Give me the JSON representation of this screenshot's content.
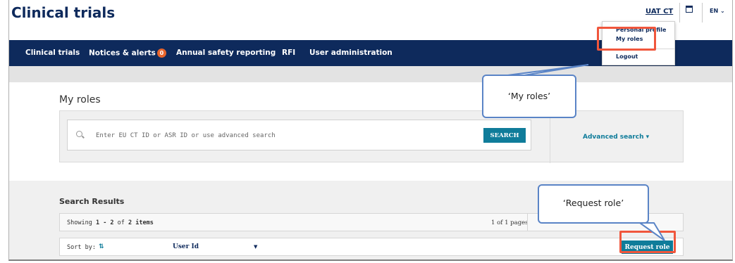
{
  "header": {
    "app_title": "Clinical trials",
    "user_link": "UAT CT",
    "calendar_icon": "calendar-icon",
    "language": "EN ⌄"
  },
  "nav": {
    "items": [
      {
        "label": "Clinical trials"
      },
      {
        "label": "Notices & alerts",
        "badge": "0"
      },
      {
        "label": "Annual safety reporting"
      },
      {
        "label": "RFI"
      },
      {
        "label": "User administration"
      }
    ]
  },
  "user_menu": {
    "items": [
      {
        "label": "Personal profile"
      },
      {
        "label": "My roles"
      },
      {
        "label": "Logout"
      }
    ]
  },
  "page": {
    "heading": "My roles"
  },
  "search": {
    "icon": "search-icon",
    "placeholder": "Enter EU CT ID or ASR ID or use advanced search",
    "button_label": "SEARCH",
    "advanced_label": "Advanced search ▾"
  },
  "results": {
    "title": "Search Results",
    "showing_prefix": "Showing",
    "range": "1 - 2",
    "of_label": "of",
    "total": "2 items",
    "pages": "1 of 1 pages",
    "sort_label": "Sort by:",
    "sort_icon": "⇅",
    "sort_value": "User Id",
    "sort_caret": "▼",
    "request_role_label": "Request role"
  },
  "callouts": {
    "my_roles": "‘My roles’",
    "request_role": "‘Request role’"
  },
  "colors": {
    "navy": "#0e2a5c",
    "teal": "#0f7c9a",
    "highlight": "#f0563c",
    "callout_border": "#5a84c6",
    "badge": "#e8652c"
  }
}
